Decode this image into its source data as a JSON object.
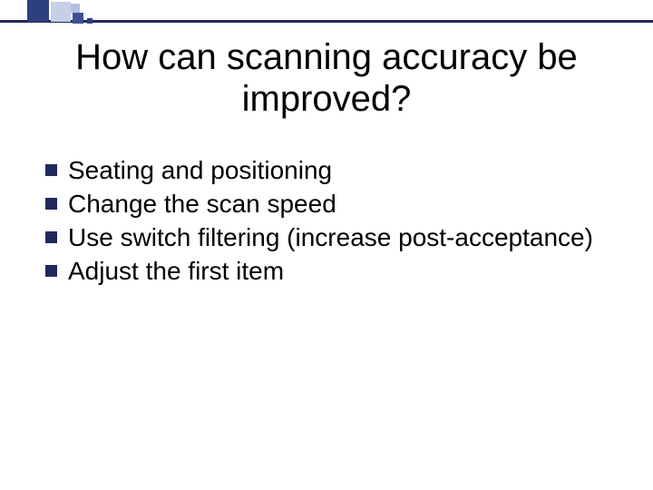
{
  "title": "How can scanning accuracy be improved?",
  "bullets": [
    "Seating and positioning",
    "Change the scan speed",
    "Use switch filtering (increase post-acceptance)",
    " Adjust the first item"
  ]
}
